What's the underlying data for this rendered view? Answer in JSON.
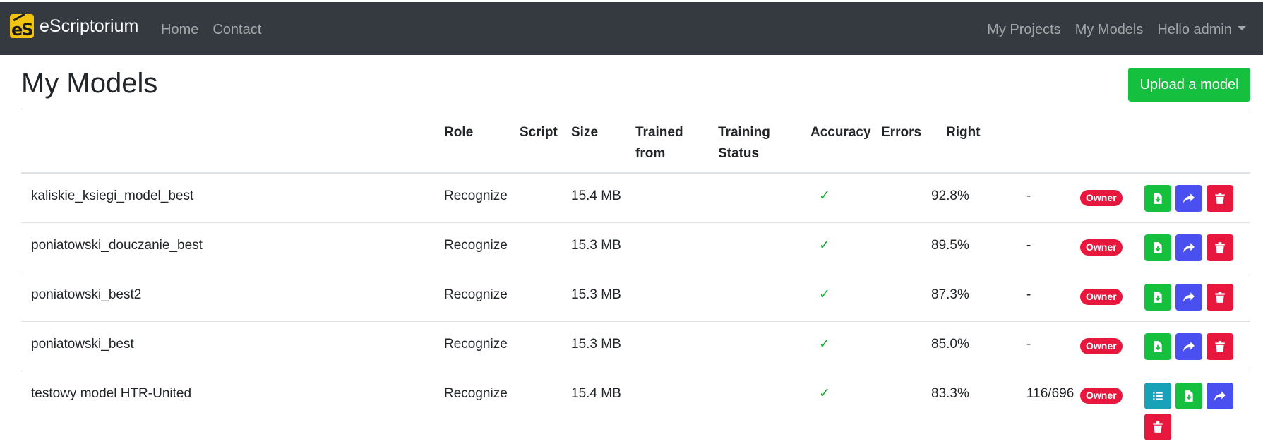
{
  "navbar": {
    "brand": "eScriptorium",
    "logo_text": "eS",
    "links_left": [
      "Home",
      "Contact"
    ],
    "links_right": [
      "My Projects",
      "My Models"
    ],
    "user_menu": "Hello admin"
  },
  "page": {
    "title": "My Models",
    "upload_button": "Upload a model"
  },
  "table": {
    "headers": {
      "role": "Role",
      "script": "Script",
      "size": "Size",
      "trained_from_1": "Trained",
      "trained_from_2": "from",
      "status_1": "Training",
      "status_2": "Status",
      "accuracy": "Accuracy",
      "errors": "Errors",
      "right": "Right"
    },
    "rows": [
      {
        "name": "kaliskie_ksiegi_model_best",
        "role": "Recognize",
        "script": "",
        "size": "15.4 MB",
        "trained_from": "",
        "status": "✓",
        "accuracy": "92.8%",
        "errors": "-",
        "right": "Owner"
      },
      {
        "name": "poniatowski_douczanie_best",
        "role": "Recognize",
        "script": "",
        "size": "15.3 MB",
        "trained_from": "",
        "status": "✓",
        "accuracy": "89.5%",
        "errors": "-",
        "right": "Owner"
      },
      {
        "name": "poniatowski_best2",
        "role": "Recognize",
        "script": "",
        "size": "15.3 MB",
        "trained_from": "",
        "status": "✓",
        "accuracy": "87.3%",
        "errors": "-",
        "right": "Owner"
      },
      {
        "name": "poniatowski_best",
        "role": "Recognize",
        "script": "",
        "size": "15.3 MB",
        "trained_from": "",
        "status": "✓",
        "accuracy": "85.0%",
        "errors": "-",
        "right": "Owner"
      },
      {
        "name": "testowy model HTR-United",
        "role": "Recognize",
        "script": "",
        "size": "15.4 MB",
        "trained_from": "",
        "status": "✓",
        "accuracy": "83.3%",
        "errors": "116/696",
        "right": "Owner"
      }
    ]
  },
  "icons": {
    "download": "file-download-icon",
    "share": "share-icon",
    "delete": "trash-icon",
    "list": "list-icon"
  },
  "colors": {
    "navbar": "#343a40",
    "success": "#15c03e",
    "primary": "#4a4ff0",
    "danger": "#e8173e",
    "info": "#17a2b8",
    "logo": "#f1c40f"
  }
}
